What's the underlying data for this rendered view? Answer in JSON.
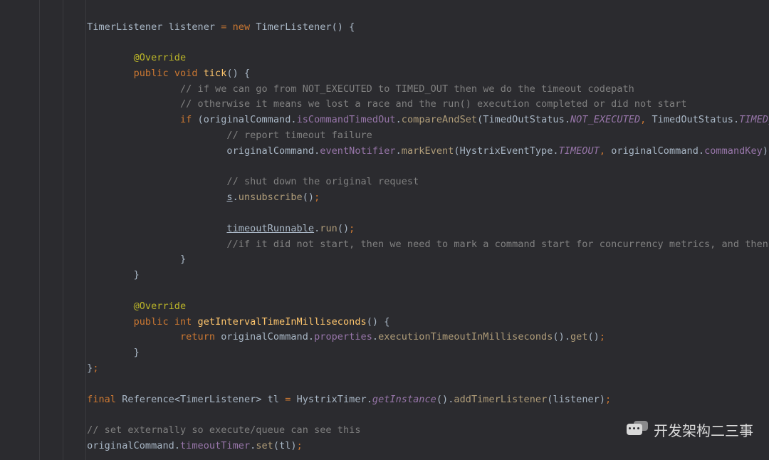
{
  "code": {
    "lines": [
      {
        "indent": 3,
        "tokens": [
          [
            "type",
            "TimerListener listener "
          ],
          [
            "kw",
            "= "
          ],
          [
            "kw",
            "new "
          ],
          [
            "type",
            "TimerListener"
          ],
          [
            "par",
            "() {"
          ]
        ]
      },
      {
        "indent": 0,
        "tokens": [
          [
            "",
            ""
          ]
        ]
      },
      {
        "indent": 5,
        "tokens": [
          [
            "ann",
            "@Override"
          ]
        ]
      },
      {
        "indent": 5,
        "tokens": [
          [
            "kw",
            "public "
          ],
          [
            "kw",
            "void "
          ],
          [
            "mdecl",
            "tick"
          ],
          [
            "par",
            "() {"
          ]
        ]
      },
      {
        "indent": 7,
        "tokens": [
          [
            "cmt",
            "// if we can go from NOT_EXECUTED to TIMED_OUT then we do the timeout codepath"
          ]
        ]
      },
      {
        "indent": 7,
        "tokens": [
          [
            "cmt",
            "// otherwise it means we lost a race and the run() execution completed or did not start"
          ]
        ]
      },
      {
        "indent": 7,
        "tokens": [
          [
            "kw",
            "if "
          ],
          [
            "par",
            "("
          ],
          [
            "type",
            "originalCommand"
          ],
          [
            "par",
            "."
          ],
          [
            "statn",
            "isCommandTimedOut"
          ],
          [
            "par",
            "."
          ],
          [
            "mcall",
            "compareAndSet"
          ],
          [
            "par",
            "("
          ],
          [
            "type",
            "TimedOutStatus"
          ],
          [
            "par",
            "."
          ],
          [
            "stat",
            "NOT_EXECUTED"
          ],
          [
            "semi",
            ","
          ],
          [
            "type",
            " TimedOutStatus"
          ],
          [
            "par",
            "."
          ],
          [
            "stat",
            "TIMED_OUT"
          ],
          [
            "par",
            "))"
          ],
          [
            "par",
            " {"
          ]
        ]
      },
      {
        "indent": 9,
        "tokens": [
          [
            "cmt",
            "// report timeout failure"
          ]
        ]
      },
      {
        "indent": 9,
        "tokens": [
          [
            "type",
            "originalCommand"
          ],
          [
            "par",
            "."
          ],
          [
            "statn",
            "eventNotifier"
          ],
          [
            "par",
            "."
          ],
          [
            "mcall",
            "markEvent"
          ],
          [
            "par",
            "("
          ],
          [
            "type",
            "HystrixEventType"
          ],
          [
            "par",
            "."
          ],
          [
            "stat",
            "TIMEOUT"
          ],
          [
            "semi",
            ","
          ],
          [
            "type",
            " originalCommand"
          ],
          [
            "par",
            "."
          ],
          [
            "statn",
            "commandKey"
          ],
          [
            "par",
            ")"
          ],
          [
            "semi",
            ";"
          ]
        ]
      },
      {
        "indent": 0,
        "tokens": [
          [
            "",
            ""
          ]
        ]
      },
      {
        "indent": 9,
        "tokens": [
          [
            "cmt",
            "// shut down the original request"
          ]
        ]
      },
      {
        "indent": 9,
        "tokens": [
          [
            "und",
            "s"
          ],
          [
            "par",
            "."
          ],
          [
            "mcall",
            "unsubscribe"
          ],
          [
            "par",
            "()"
          ],
          [
            "semi",
            ";"
          ]
        ]
      },
      {
        "indent": 0,
        "tokens": [
          [
            "",
            ""
          ]
        ]
      },
      {
        "indent": 9,
        "tokens": [
          [
            "und",
            "timeoutRunnable"
          ],
          [
            "par",
            "."
          ],
          [
            "mcall",
            "run"
          ],
          [
            "par",
            "()"
          ],
          [
            "semi",
            ";"
          ]
        ]
      },
      {
        "indent": 9,
        "tokens": [
          [
            "cmt",
            "//if it did not start, then we need to mark a command start for concurrency metrics, and then issue the timeout"
          ]
        ]
      },
      {
        "indent": 7,
        "tokens": [
          [
            "par",
            "}"
          ]
        ]
      },
      {
        "indent": 5,
        "tokens": [
          [
            "par",
            "}"
          ]
        ]
      },
      {
        "indent": 0,
        "tokens": [
          [
            "",
            ""
          ]
        ]
      },
      {
        "indent": 5,
        "tokens": [
          [
            "ann",
            "@Override"
          ]
        ]
      },
      {
        "indent": 5,
        "tokens": [
          [
            "kw",
            "public "
          ],
          [
            "kw",
            "int "
          ],
          [
            "mdecl",
            "getIntervalTimeInMilliseconds"
          ],
          [
            "par",
            "() {"
          ]
        ]
      },
      {
        "indent": 7,
        "tokens": [
          [
            "kw",
            "return "
          ],
          [
            "type",
            "originalCommand"
          ],
          [
            "par",
            "."
          ],
          [
            "statn",
            "properties"
          ],
          [
            "par",
            "."
          ],
          [
            "mcall",
            "executionTimeoutInMilliseconds"
          ],
          [
            "par",
            "()."
          ],
          [
            "mcall",
            "get"
          ],
          [
            "par",
            "()"
          ],
          [
            "semi",
            ";"
          ]
        ]
      },
      {
        "indent": 5,
        "tokens": [
          [
            "par",
            "}"
          ]
        ]
      },
      {
        "indent": 3,
        "tokens": [
          [
            "par",
            "}"
          ],
          [
            "semi",
            ";"
          ]
        ]
      },
      {
        "indent": 0,
        "tokens": [
          [
            "",
            ""
          ]
        ]
      },
      {
        "indent": 3,
        "tokens": [
          [
            "kw",
            "final "
          ],
          [
            "type",
            "Reference<TimerListener> tl "
          ],
          [
            "kw",
            "= "
          ],
          [
            "type",
            "HystrixTimer"
          ],
          [
            "par",
            "."
          ],
          [
            "stat",
            "getInstance"
          ],
          [
            "par",
            "()."
          ],
          [
            "mcall",
            "addTimerListener"
          ],
          [
            "par",
            "("
          ],
          [
            "type",
            "listener"
          ],
          [
            "par",
            ")"
          ],
          [
            "semi",
            ";"
          ]
        ]
      },
      {
        "indent": 0,
        "tokens": [
          [
            "",
            ""
          ]
        ]
      },
      {
        "indent": 3,
        "tokens": [
          [
            "cmt",
            "// set externally so execute/queue can see this"
          ]
        ]
      },
      {
        "indent": 3,
        "tokens": [
          [
            "type",
            "originalCommand"
          ],
          [
            "par",
            "."
          ],
          [
            "statn",
            "timeoutTimer"
          ],
          [
            "par",
            "."
          ],
          [
            "mcall",
            "set"
          ],
          [
            "par",
            "("
          ],
          [
            "type",
            "tl"
          ],
          [
            "par",
            ")"
          ],
          [
            "semi",
            ";"
          ]
        ]
      }
    ],
    "unit_indent": "    ",
    "base_pad_left": 24
  },
  "guides_x": [
    55,
    88,
    120
  ],
  "watermark_text": "开发架构二三事"
}
